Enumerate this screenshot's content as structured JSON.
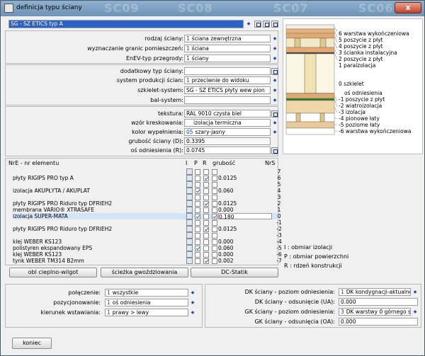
{
  "window": {
    "title": "definicja typu ściany",
    "bg_tabs": [
      "SC09",
      "SC08",
      "SC07",
      "SC06"
    ],
    "close": "x"
  },
  "wall_type": {
    "value": "SG - SZ ETICS typ A"
  },
  "form": {
    "rodzaj": {
      "label": "rodzaj ściany:",
      "num": "1",
      "value": "ściana zewnętrzna"
    },
    "wyznaczanie": {
      "label": "wyznaczanie granic pomieszczeń:",
      "num": "1",
      "value": "ściana"
    },
    "enev": {
      "label": "EnEV-typ przegrody:",
      "num": "1",
      "value": "ściany"
    },
    "dodatkowy": {
      "label": "dodatkowy typ ściany:",
      "value": ""
    },
    "system_prod": {
      "label": "system produkcji ścian:",
      "num": "1",
      "value": "przeciwnie do widoku"
    },
    "szkielet": {
      "label": "szkielet-system:",
      "value": "SG - SZ ETICS płyty wew pion"
    },
    "bal": {
      "label": "bal-system:",
      "value": ""
    },
    "tekstura": {
      "label": "tekstura:",
      "value": "RAL 9010 czysta biel"
    },
    "wzor": {
      "label": "wzór kreskowania:",
      "value": "izolacja termiczna"
    },
    "kolor": {
      "label": "kolor wypełnienia:",
      "num": "05",
      "value": "szary-jasny"
    },
    "grubosc": {
      "label": "grubość ściany (D):",
      "value": "0.3395"
    },
    "odniesienie": {
      "label": "oś odniesienia (R):",
      "value": "0.0745"
    }
  },
  "layers_header": {
    "name": "NrE - nr elementu",
    "i": "I",
    "p": "P",
    "r": "R",
    "thick": "grubość",
    "nrs": "NrS"
  },
  "layers": [
    {
      "name": "",
      "i": false,
      "p": false,
      "r": false,
      "thick": "",
      "nr": "7"
    },
    {
      "name": "płyty RIGIPS PRO typ A",
      "i": false,
      "p": true,
      "r": false,
      "thick": "0.0125",
      "nr": "6"
    },
    {
      "name": "",
      "i": false,
      "p": false,
      "r": false,
      "thick": "",
      "nr": "5"
    },
    {
      "name": "izolacja AKUPŁYTA / AKUPLAT",
      "i": true,
      "p": false,
      "r": false,
      "thick": "0.060",
      "nr": "4"
    },
    {
      "name": "",
      "i": false,
      "p": false,
      "r": false,
      "thick": "",
      "nr": "3"
    },
    {
      "name": "płyty RIGIPS PRO Riduro typ DFRIEH2",
      "i": false,
      "p": true,
      "r": false,
      "thick": "0.0125",
      "nr": "2"
    },
    {
      "name": "membrana VARIO® XTRASAFE",
      "i": false,
      "p": false,
      "r": false,
      "thick": "0.000",
      "nr": "1"
    },
    {
      "name": "izolacja SUPER-MATA",
      "i": true,
      "p": false,
      "r": true,
      "thick": "0.180",
      "nr": "0"
    },
    {
      "name": "",
      "i": false,
      "p": false,
      "r": false,
      "thick": "",
      "nr": "-1"
    },
    {
      "name": "płyty RIGIPS PRO Riduro typ DFRIEH2",
      "i": false,
      "p": true,
      "r": false,
      "thick": "0.0125",
      "nr": "-2"
    },
    {
      "name": "",
      "i": false,
      "p": false,
      "r": false,
      "thick": "",
      "nr": "-3"
    },
    {
      "name": "klej WEBER KS123",
      "i": false,
      "p": false,
      "r": false,
      "thick": "0.000",
      "nr": "-4"
    },
    {
      "name": "polistyren ekspandowany EPS",
      "i": true,
      "p": false,
      "r": false,
      "thick": "0.060",
      "nr": "-5"
    },
    {
      "name": "klej WEBER KS123",
      "i": false,
      "p": false,
      "r": false,
      "thick": "0.000",
      "nr": "-6"
    },
    {
      "name": "tynk WEBER TM314 B2mm",
      "i": false,
      "p": true,
      "r": false,
      "thick": "0.002",
      "nr": "-7"
    }
  ],
  "buttons": {
    "obl": "obl cieplno-wilgot",
    "sciezka": "ścieżka gwoździowania",
    "dc": "DC-Statik",
    "koniec": "koniec"
  },
  "legend": {
    "i": "I : obmiar izolacji",
    "p": "P : obmiar powierzchni",
    "r": "R : rdzeń konstrukcji"
  },
  "diagram_labels": {
    "top": [
      "6 warstwa wykończeniowa",
      "5 poszycie z płyt",
      "4 poszycie z płyt",
      "3 ścianka instalacyjna",
      "2 poszycie z płyt",
      "1 paraizolacja"
    ],
    "mid": "0 szkielet",
    "axis": "oś odniesienia",
    "bottom": [
      "-1 poszycie z płyt",
      "-2 wiatroizolacja",
      "-3 izolacja",
      "-4 pionowe łaty",
      "-5 poziome łaty",
      "-6 warstwa wykończeniowa"
    ]
  },
  "bottom_form": {
    "polaczenie": {
      "label": "połączenie:",
      "num": "1",
      "value": "wszystkie"
    },
    "pozycjonowanie": {
      "label": "pozycjonowanie:",
      "num": "1",
      "value": "oś odniesienia"
    },
    "kierunek": {
      "label": "kierunek wstawiania:",
      "num": "1",
      "value": "prawy > lewy"
    },
    "dk_poziom": {
      "label": "DK ściany - poziom odniesienia:",
      "num": "1",
      "value": "DK kondygnacji-aktualne"
    },
    "dk_odsun": {
      "label": "DK ściany - odsunięcie (UA):",
      "value": "0.000"
    },
    "gk_poziom": {
      "label": "GK ściany - poziom odniesienia:",
      "num": "3",
      "value": "DK warstwy 0 górnego st"
    },
    "gk_odsun": {
      "label": "GK ściany - odsunięcia (OA):",
      "value": "0.000"
    }
  },
  "colors": {
    "titlebar": "#7fa3c6",
    "accent": "#2a62c5",
    "selected": "#d5e3f7"
  }
}
